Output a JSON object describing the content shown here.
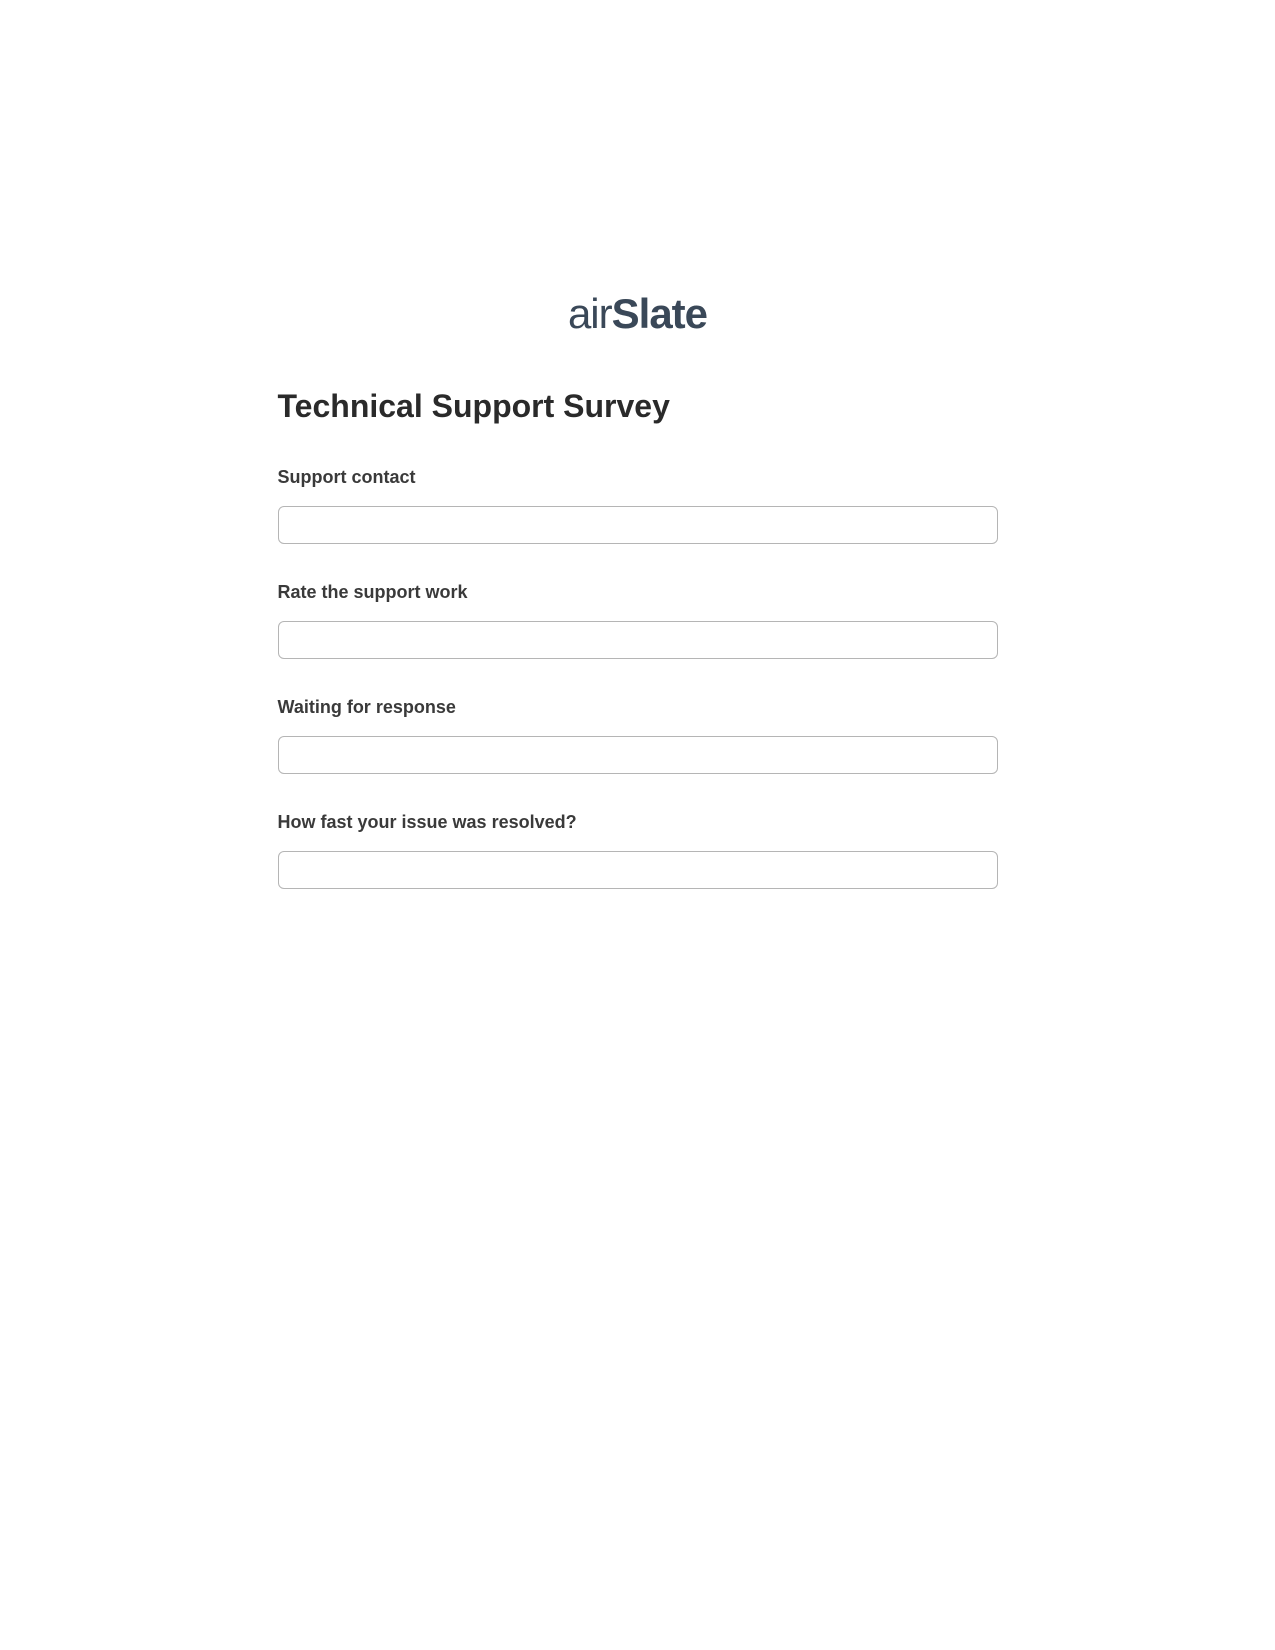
{
  "logo": {
    "prefix": "air",
    "suffix": "Slate"
  },
  "form": {
    "title": "Technical Support Survey",
    "fields": [
      {
        "label": "Support contact",
        "value": ""
      },
      {
        "label": "Rate the support work",
        "value": ""
      },
      {
        "label": "Waiting for response",
        "value": ""
      },
      {
        "label": "How fast your issue was resolved?",
        "value": ""
      }
    ]
  }
}
